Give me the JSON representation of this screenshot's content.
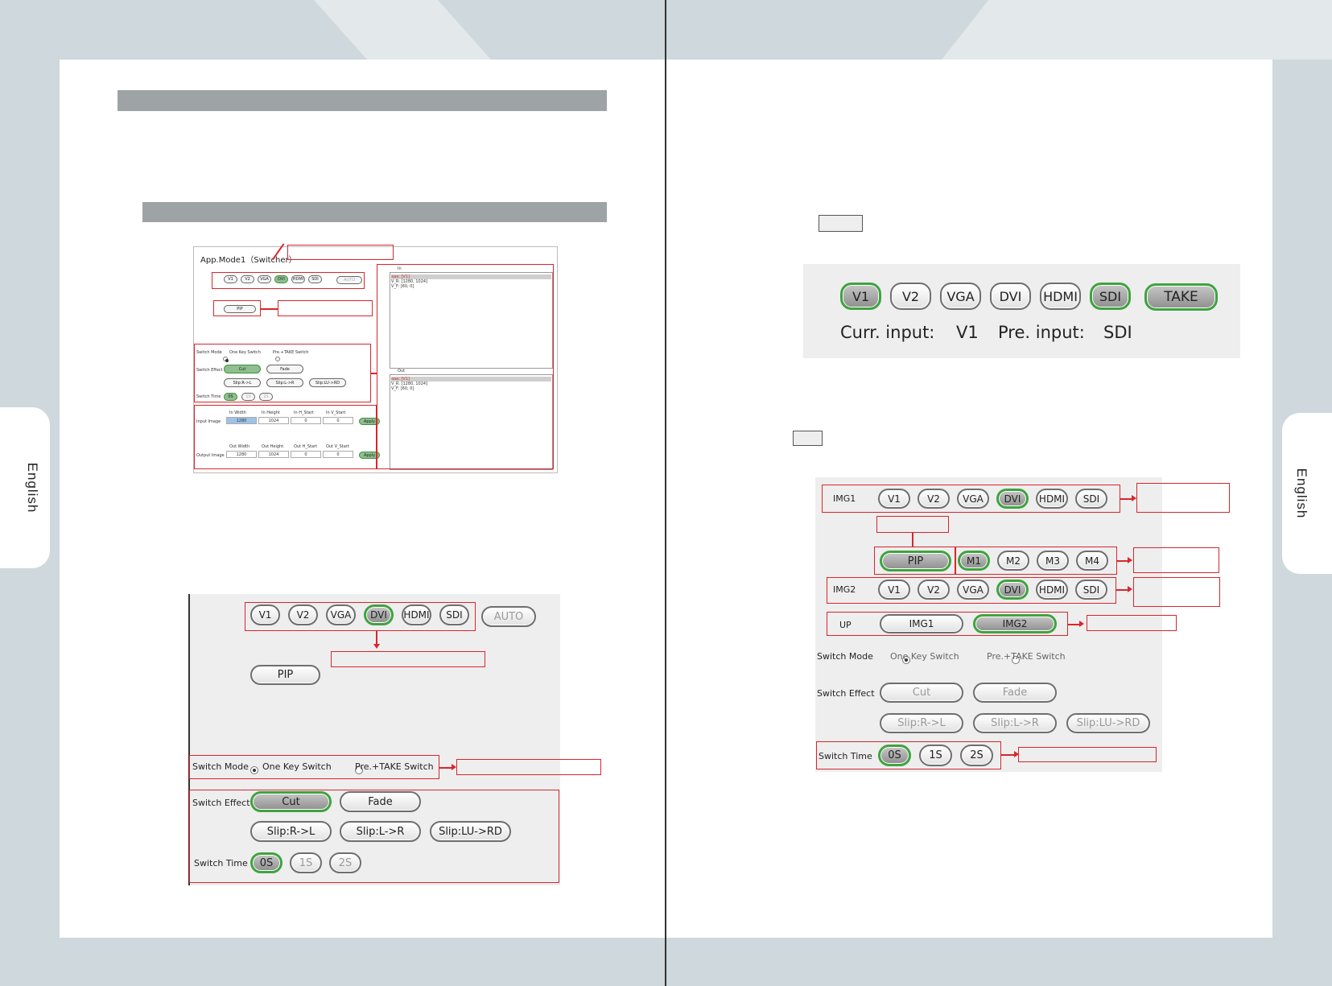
{
  "page": {
    "language_tab": "English"
  },
  "left_small": {
    "title": "App.Mode1（Switcher）",
    "inputs": [
      "V1",
      "V2",
      "VGA",
      "DVI",
      "HDMI",
      "SDI"
    ],
    "active_input": "DVI",
    "auto": "AUTO",
    "pip": "PIP",
    "switch_mode_label": "Switch Mode",
    "one_key": "One Key Switch",
    "pre_take": "Pre.+TAKE Switch",
    "switch_effect_label": "Switch Effect",
    "effects": [
      "Cut",
      "Fade"
    ],
    "slips": [
      "Slip:R->L",
      "Slip:L->R",
      "Slip:LU->RD"
    ],
    "switch_time_label": "Switch Time",
    "times": [
      "0S",
      "1S",
      "2S"
    ],
    "input_image_label": "Input Image",
    "input_headers": [
      "In Width",
      "In Height",
      "In H_Start",
      "In V_Start"
    ],
    "input_values": [
      "1280",
      "1024",
      "0",
      "0"
    ],
    "output_image_label": "Output Image",
    "output_headers": [
      "Out Width",
      "Out Height",
      "Out H_Start",
      "Out V_Start"
    ],
    "output_values": [
      "1280",
      "1024",
      "0",
      "0"
    ],
    "apply": "Apply",
    "in_list_label": "In",
    "in_list": [
      "aaa: [V1]",
      "V_R: [1280, 1024]",
      "V_F: [60, 0]"
    ],
    "out_list_label": "Out",
    "out_list": [
      "aaa: [V1]",
      "V_R: [1280, 1024]",
      "V_F: [60, 0]"
    ]
  },
  "left_big": {
    "inputs": [
      "V1",
      "V2",
      "VGA",
      "DVI",
      "HDMI",
      "SDI"
    ],
    "active_input": "DVI",
    "auto": "AUTO",
    "pip": "PIP",
    "switch_mode_label": "Switch Mode",
    "one_key": "One Key Switch",
    "pre_take": "Pre.+TAKE Switch",
    "switch_effect_label": "Switch Effect",
    "effects": [
      "Cut",
      "Fade"
    ],
    "slips": [
      "Slip:R->L",
      "Slip:L->R",
      "Slip:LU->RD"
    ],
    "switch_time_label": "Switch Time",
    "times": [
      "0S",
      "1S",
      "2S"
    ]
  },
  "right_take": {
    "inputs": [
      "V1",
      "V2",
      "VGA",
      "DVI",
      "HDMI",
      "SDI"
    ],
    "take": "TAKE",
    "curr_label": "Curr. input:",
    "curr_value": "V1",
    "pre_label": "Pre. input:",
    "pre_value": "SDI"
  },
  "right_pip": {
    "img1_label": "IMG1",
    "img2_label": "IMG2",
    "inputs": [
      "V1",
      "V2",
      "VGA",
      "DVI",
      "HDMI",
      "SDI"
    ],
    "pip": "PIP",
    "modes": [
      "M1",
      "M2",
      "M3",
      "M4"
    ],
    "up_label": "UP",
    "up_options": [
      "IMG1",
      "IMG2"
    ],
    "switch_mode_label": "Switch Mode",
    "one_key": "One Key Switch",
    "pre_take": "Pre.+TAKE Switch",
    "switch_effect_label": "Switch Effect",
    "effects": [
      "Cut",
      "Fade"
    ],
    "slips": [
      "Slip:R->L",
      "Slip:L->R",
      "Slip:LU->RD"
    ],
    "switch_time_label": "Switch Time",
    "times": [
      "0S",
      "1S",
      "2S"
    ]
  },
  "colors": {
    "accent_green": "#3fa33f",
    "annotation_red": "#d8262c",
    "background_band": "#cfd8dc",
    "header_bar": "#9ea3a5"
  }
}
